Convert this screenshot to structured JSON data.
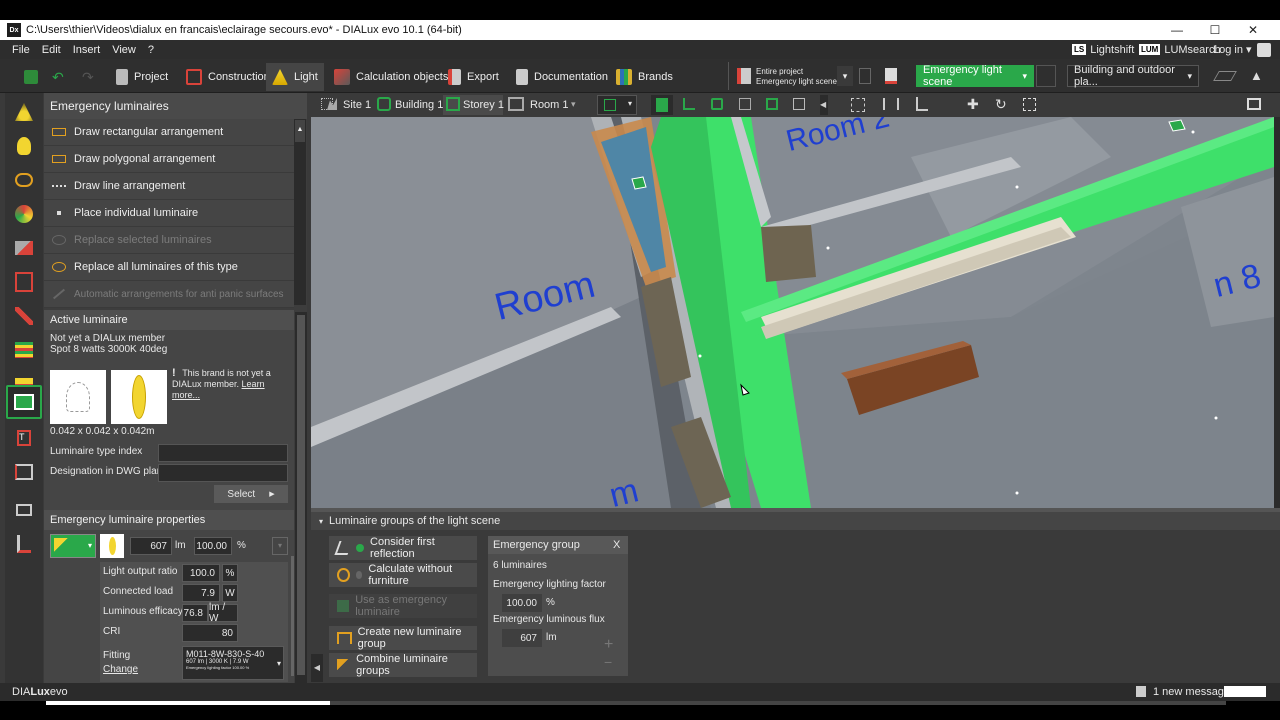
{
  "titlebar": {
    "app_icon": "Dx",
    "title": "C:\\Users\\thier\\Videos\\dialux en francais\\eclairage secours.evo* - DIALux evo 10.1  (64-bit)",
    "minimize": "—",
    "maximize": "☐",
    "close": "✕"
  },
  "menubar": {
    "items": [
      "File",
      "Edit",
      "Insert",
      "View",
      "?"
    ],
    "lightshift_badge": "LS",
    "lightshift": "Lightshift",
    "lumsearch_badge": "LUM",
    "lumsearch": "LUMsearch",
    "login": "Log in ▾"
  },
  "toolbar": {
    "tabs": [
      "Project",
      "Construction",
      "Light",
      "Calculation objects",
      "Export",
      "Documentation",
      "Brands"
    ],
    "calc_line1": "Entire project",
    "calc_line2": "Emergency light scene",
    "scene_select": "Emergency light scene",
    "view_select": "Building and outdoor pla..."
  },
  "viewport_toolbar": {
    "breadcrumbs": [
      "Site 1",
      "Building 1",
      "Storey 1",
      "Room 1"
    ]
  },
  "left_panel": {
    "title": "Emergency luminaires",
    "actions": [
      {
        "label": "Draw rectangular arrangement",
        "enabled": true
      },
      {
        "label": "Draw polygonal arrangement",
        "enabled": true
      },
      {
        "label": "Draw line arrangement",
        "enabled": true
      },
      {
        "label": "Place individual luminaire",
        "enabled": true
      },
      {
        "label": "Replace selected luminaires",
        "enabled": false
      },
      {
        "label": "Replace all luminaires of this type",
        "enabled": true
      },
      {
        "label": "Automatic arrangements for anti panic surfaces",
        "enabled": false
      }
    ],
    "active": {
      "title": "Active luminaire",
      "manufacturer": "Not yet a DIALux member",
      "name": "Spot 8 watts 3000K 40deg",
      "warn_mark": "!",
      "warn_text": "This brand is not yet a DIALux member.",
      "learn_more": "Learn more...",
      "dimensions": "0.042 x 0.042 x 0.042m",
      "type_index_label": "Luminaire type index",
      "dwg_label": "Designation in DWG plan",
      "select_button": "Select"
    },
    "props": {
      "title": "Emergency luminaire properties",
      "flux": "607",
      "flux_unit": "lm",
      "factor": "100.00",
      "factor_unit": "%",
      "rows": [
        {
          "label": "Light output ratio",
          "value": "100.0",
          "unit": "%"
        },
        {
          "label": "Connected load",
          "value": "7.9",
          "unit": "W"
        },
        {
          "label": "Luminous efficacy",
          "value": "76.8",
          "unit": "lm / W"
        },
        {
          "label": "CRI",
          "value": "80",
          "unit": ""
        }
      ],
      "fitting_label": "Fitting",
      "fitting_change": "Change",
      "fitting_code": "M011-8W-830-S-40",
      "fitting_detail": "607 lm  |  3000 K  |  7.9 W",
      "fitting_small": "Emergency lighting factor 100.00 %"
    }
  },
  "viewport": {
    "labels": [
      "Room 2",
      "Room",
      "n 8",
      "m"
    ]
  },
  "bottom_panel": {
    "title": "Luminaire groups of the light scene",
    "buttons": [
      {
        "label": "Consider first reflection",
        "enabled": true
      },
      {
        "label": "Calculate without furniture",
        "enabled": true
      },
      {
        "label": "Use as emergency luminaire",
        "enabled": false
      },
      {
        "label": "Create new luminaire group",
        "enabled": true
      },
      {
        "label": "Combine luminaire groups",
        "enabled": true
      }
    ],
    "group": {
      "name": "Emergency group",
      "close": "X",
      "count": "6 luminaires",
      "factor_label": "Emergency lighting factor",
      "factor": "100.00",
      "factor_unit": "%",
      "flux_label": "Emergency luminous flux",
      "flux": "607",
      "flux_unit": "lm",
      "plus": "+",
      "minus": "−"
    }
  },
  "statusbar": {
    "brand_a": "DIA",
    "brand_b": "Lux",
    "brand_c": "evo",
    "message": "1 new message"
  },
  "colors": {
    "accent_green": "#2aa84a",
    "floor_highlight": "#3ee06a",
    "room_label": "#1f3fd0"
  }
}
